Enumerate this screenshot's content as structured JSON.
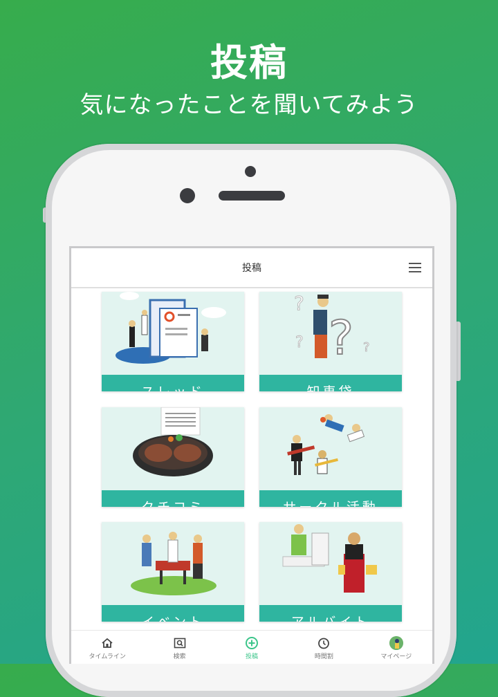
{
  "hero": {
    "title": "投稿",
    "subtitle": "気になったことを聞いてみよう"
  },
  "appbar": {
    "title": "投稿"
  },
  "cards": [
    {
      "label": "スレッド"
    },
    {
      "label": "知恵袋"
    },
    {
      "label": "クチコミ"
    },
    {
      "label": "サークル活動"
    },
    {
      "label": "イベント"
    },
    {
      "label": "アルバイト"
    }
  ],
  "tabbar": {
    "items": [
      {
        "label": "タイムライン",
        "icon": "home-icon"
      },
      {
        "label": "検索",
        "icon": "search-icon"
      },
      {
        "label": "投稿",
        "icon": "add-circle-icon",
        "active": true
      },
      {
        "label": "時間割",
        "icon": "clock-icon"
      },
      {
        "label": "マイページ",
        "icon": "avatar-icon"
      }
    ]
  },
  "colors": {
    "accent": "#2fb5a0",
    "active_tab": "#3cc58a",
    "card_bg": "#e2f4f0"
  }
}
